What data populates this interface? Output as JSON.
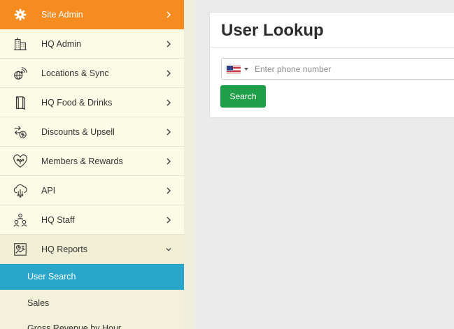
{
  "sidebar": {
    "items": [
      {
        "label": "Site Admin",
        "icon": "gear-icon"
      },
      {
        "label": "HQ Admin",
        "icon": "buildings-icon"
      },
      {
        "label": "Locations & Sync",
        "icon": "globe-signal-icon"
      },
      {
        "label": "HQ Food & Drinks",
        "icon": "menu-book-icon"
      },
      {
        "label": "Discounts & Upsell",
        "icon": "dollar-cycle-icon"
      },
      {
        "label": "Members & Rewards",
        "icon": "heart-network-icon"
      },
      {
        "label": "API",
        "icon": "cloud-network-icon"
      },
      {
        "label": "HQ Staff",
        "icon": "staff-group-icon"
      },
      {
        "label": "HQ Reports",
        "icon": "report-chart-icon"
      }
    ],
    "sub_items": [
      {
        "label": "User Search"
      },
      {
        "label": "Sales"
      },
      {
        "label": "Gross Revenue by Hour"
      }
    ]
  },
  "panel": {
    "title": "User Lookup",
    "phone_placeholder": "Enter phone number",
    "country_flag": "us-flag-icon",
    "search_label": "Search"
  },
  "colors": {
    "site_admin_bg": "#f68c1f",
    "active_sub_bg": "#2ba6cb",
    "search_button_bg": "#1e9e49",
    "sidebar_bg": "#fcfbe6"
  }
}
